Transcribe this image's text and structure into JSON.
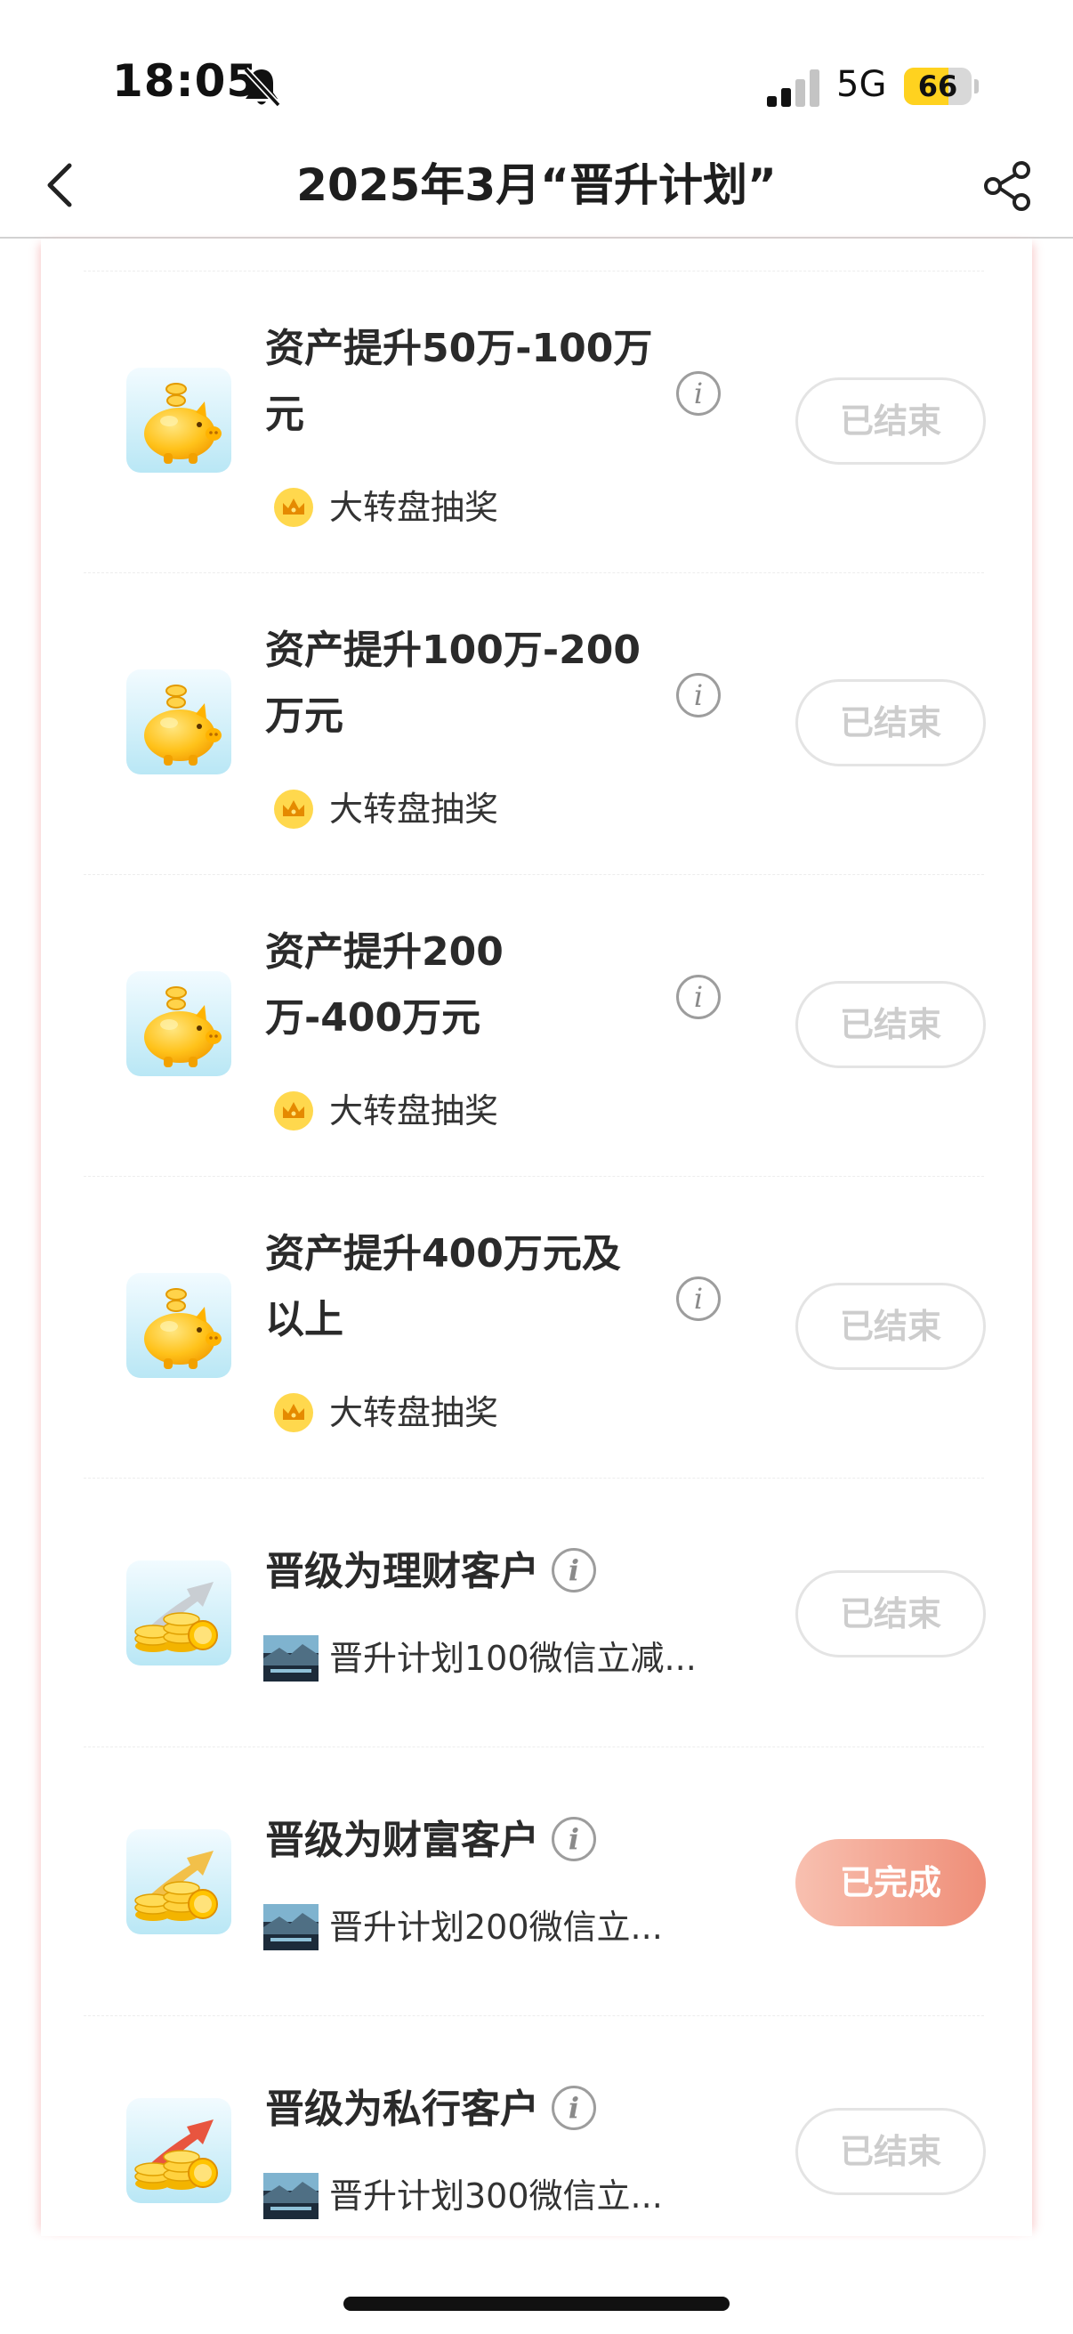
{
  "status_bar": {
    "time": "18:05",
    "bell_icon": "bell-slash-icon",
    "signal_icon": "cellular-signal-icon",
    "network": "5G",
    "battery_level": "66",
    "battery_fraction": 0.66,
    "battery_color": "#ffd21f"
  },
  "nav": {
    "back_icon": "chevron-left-icon",
    "title": "2025年3月“晋升计划”",
    "share_icon": "share-icon"
  },
  "tasks": [
    {
      "title": "资产提升50万-100万元",
      "icon": "piggy-bank-icon",
      "reward_icon": "crown-icon",
      "reward": "大转盘抽奖",
      "status": "已结束"
    },
    {
      "title": "资产提升100万-200万元",
      "icon": "piggy-bank-icon",
      "reward_icon": "crown-icon",
      "reward": "大转盘抽奖",
      "status": "已结束"
    },
    {
      "title": "资产提升200万-400万元",
      "icon": "piggy-bank-icon",
      "reward_icon": "crown-icon",
      "reward": "大转盘抽奖",
      "status": "已结束"
    },
    {
      "title": "资产提升400万元及以上",
      "icon": "piggy-bank-icon",
      "reward_icon": "crown-icon",
      "reward": "大转盘抽奖",
      "status": "已结束"
    },
    {
      "title": "晋级为理财客户",
      "icon": "coin-stack-arrow-icon",
      "reward_icon": "landscape-thumbnail-icon",
      "reward": "晋升计划100微信立减...",
      "status": "已结束"
    },
    {
      "title": "晋级为财富客户",
      "icon": "coin-stack-arrow-icon",
      "reward_icon": "landscape-thumbnail-icon",
      "reward": "晋升计划200微信立...",
      "status": "已完成"
    },
    {
      "title": "晋级为私行客户",
      "icon": "coin-stack-arrow-icon",
      "reward_icon": "landscape-thumbnail-icon",
      "reward": "晋升计划300微信立...",
      "status": "已结束"
    }
  ],
  "colors": {
    "done_button": "#ef8e78",
    "ended_button_text": "#cdcdcd",
    "card_edge": "#f8c6c6"
  }
}
